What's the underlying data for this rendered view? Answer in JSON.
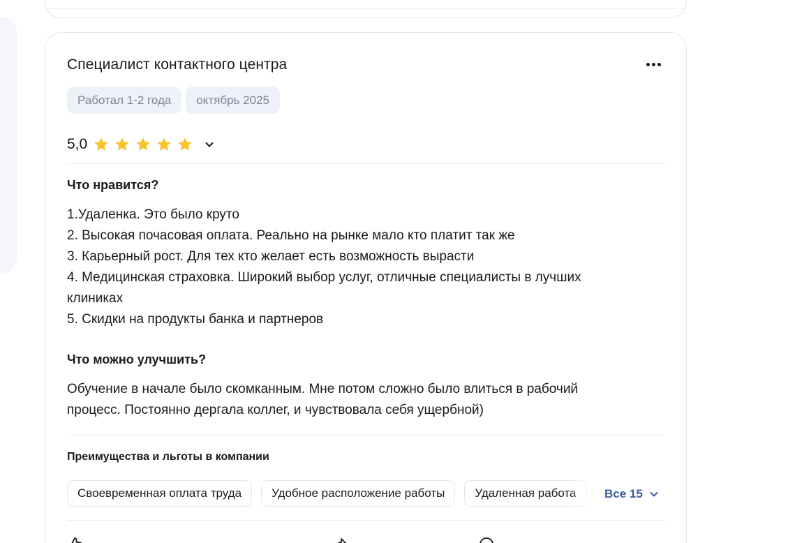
{
  "review": {
    "title": "Специалист контактного центра",
    "tags": [
      "Работал 1-2 года",
      "октябрь 2025"
    ],
    "rating": "5,0",
    "stars": 5,
    "likes_heading": "Что нравится?",
    "likes_lines": [
      "1.Удаленка. Это было круто",
      "2. Высокая почасовая оплата. Реально на рынке мало кто платит так же",
      "3. Карьерный рост. Для тех кто желает есть возможность вырасти",
      "4. Медицинская страховка. Широкий выбор услуг, отличные специалисты в лучших",
      "клиниках",
      "5. Скидки на продукты банка и партнеров"
    ],
    "improve_heading": "Что можно улучшить?",
    "improve_lines": [
      "Обучение в начале было скомканным. Мне потом сложно было влиться в рабочий",
      "процесс. Постоянно дергала коллег, и чувствовала себя ущербной)"
    ],
    "benefits_heading": "Преимущества и льготы в компании",
    "benefits": [
      "Своевременная оплата труда",
      "Удобное расположение работы",
      "Удаленная работа"
    ],
    "show_all_label": "Все 15"
  },
  "colors": {
    "star": "#f7c32b",
    "tag_bg": "#eef1f7",
    "tag_text": "#7a8499",
    "link": "#3b5ba5",
    "border": "#e3e6ec"
  },
  "icons": {
    "more": "more-horizontal-icon",
    "star": "star-icon",
    "chevron": "chevron-down-icon"
  }
}
